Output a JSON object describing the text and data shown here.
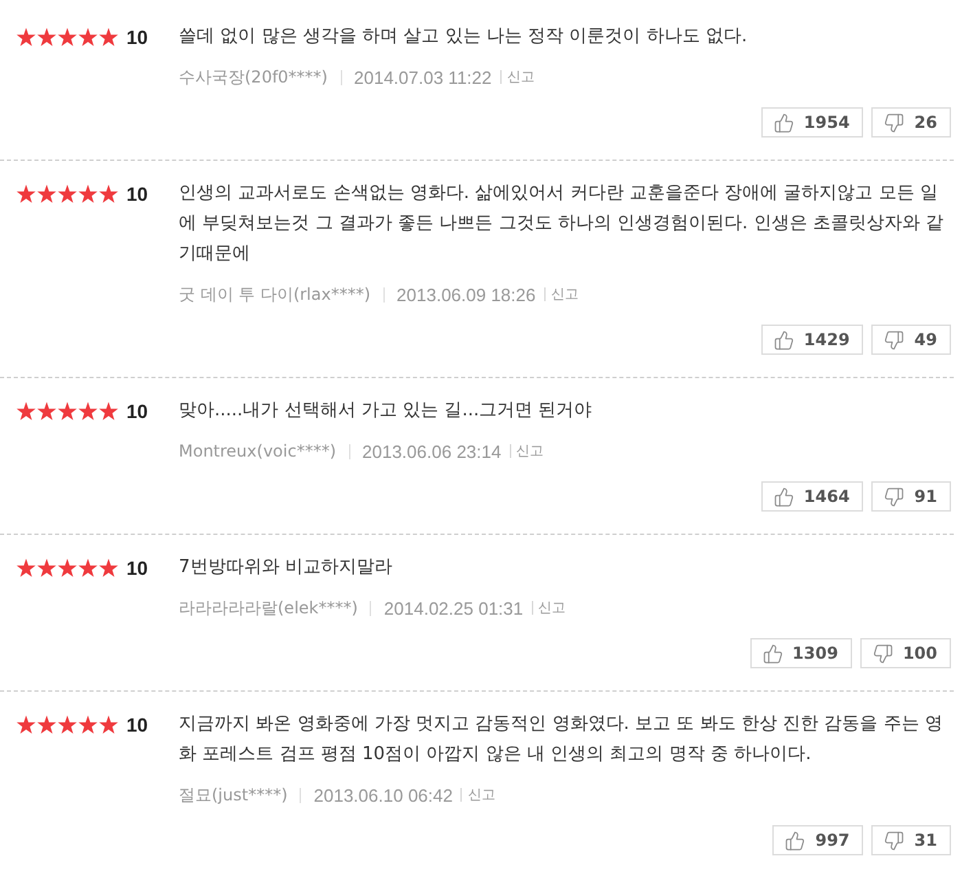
{
  "reviews": [
    {
      "stars": 5,
      "score": "10",
      "text": "쓸데 없이 많은 생각을 하며 살고 있는 나는 정작 이룬것이 하나도 없다.",
      "author": "수사국장(20f0****)",
      "date": "2014.07.03 11:22",
      "report": "신고",
      "likes": "1954",
      "dislikes": "26"
    },
    {
      "stars": 5,
      "score": "10",
      "text": "인생의 교과서로도 손색없는 영화다. 삶에있어서 커다란 교훈을준다 장애에 굴하지않고 모든 일에 부딪쳐보는것 그 결과가 좋든 나쁘든 그것도 하나의 인생경험이된다. 인생은 초콜릿상자와 같기때문에",
      "author": "굿 데이 투 다이(rlax****)",
      "date": "2013.06.09 18:26",
      "report": "신고",
      "likes": "1429",
      "dislikes": "49"
    },
    {
      "stars": 5,
      "score": "10",
      "text": "맞아.....내가 선택해서 가고 있는 길...그거면 된거야",
      "author": "Montreux(voic****)",
      "date": "2013.06.06 23:14",
      "report": "신고",
      "likes": "1464",
      "dislikes": "91"
    },
    {
      "stars": 5,
      "score": "10",
      "text": "7번방따위와 비교하지말라",
      "author": "라라라라라랄(elek****)",
      "date": "2014.02.25 01:31",
      "report": "신고",
      "likes": "1309",
      "dislikes": "100"
    },
    {
      "stars": 5,
      "score": "10",
      "text": "지금까지 봐온 영화중에 가장 멋지고 감동적인 영화였다. 보고 또 봐도 한상 진한 감동을 주는 영화 포레스트 검프 평점 10점이 아깝지 않은 내 인생의 최고의 명작 중 하나이다.",
      "author": "절묘(just****)",
      "date": "2013.06.10 06:42",
      "report": "신고",
      "likes": "997",
      "dislikes": "31"
    }
  ]
}
